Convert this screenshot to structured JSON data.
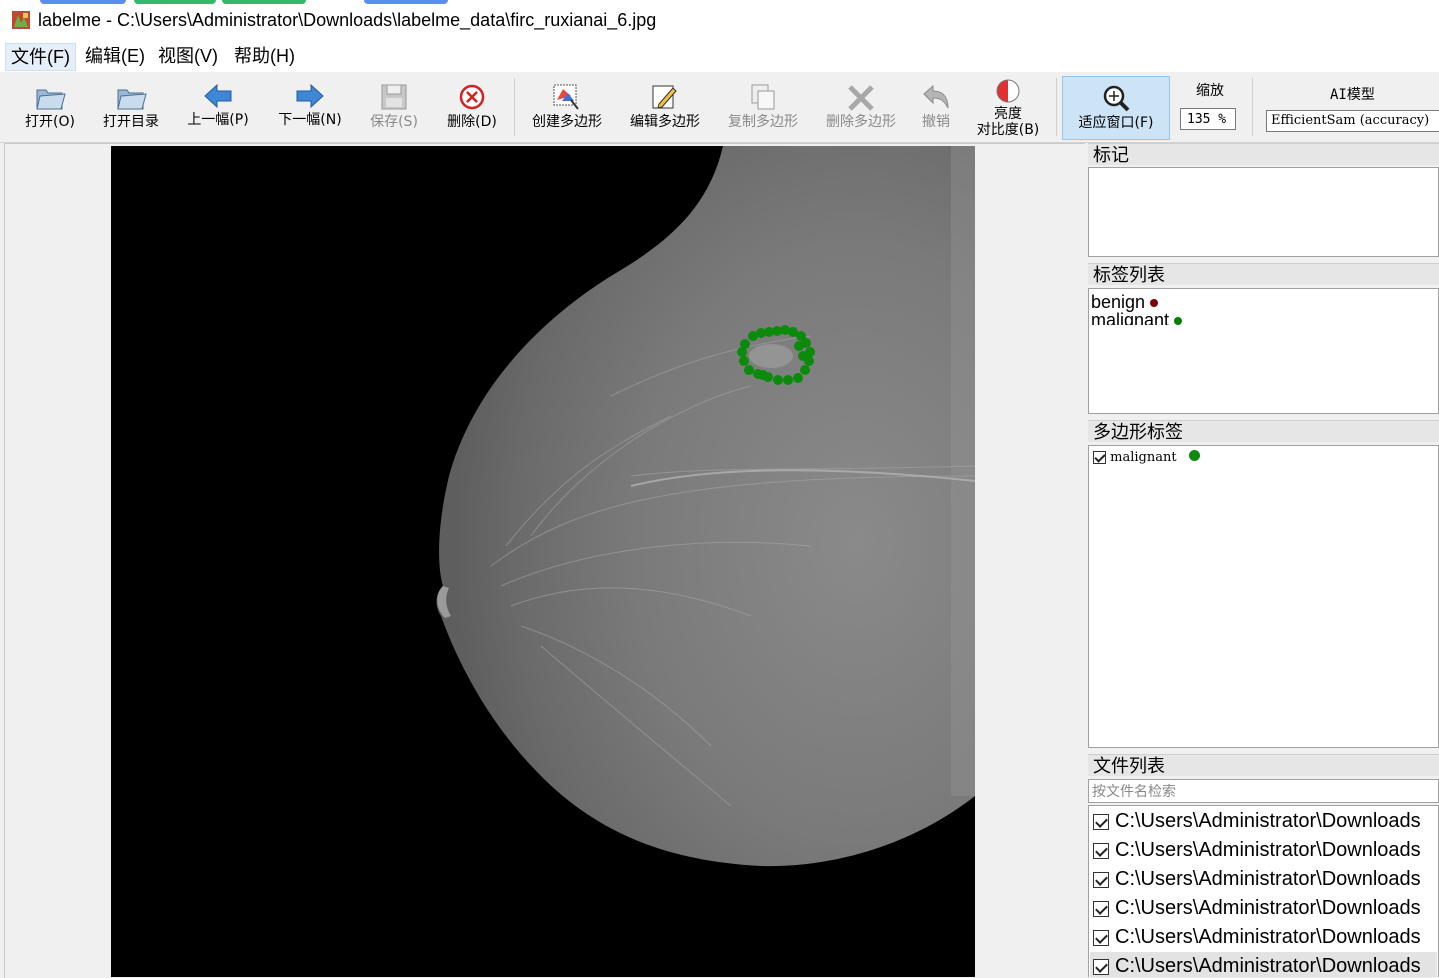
{
  "window": {
    "title": "labelme - C:\\Users\\Administrator\\Downloads\\labelme_data\\firc_ruxianai_6.jpg",
    "app_icon": "labelme-app-icon"
  },
  "menu": {
    "items": [
      {
        "label": "文件(F)"
      },
      {
        "label": "编辑(E)"
      },
      {
        "label": "视图(V)"
      },
      {
        "label": "帮助(H)"
      }
    ]
  },
  "toolbar": {
    "open": "打开(O)",
    "open_dir": "打开目录",
    "prev": "上一幅(P)",
    "next": "下一幅(N)",
    "save": "保存(S)",
    "delete": "删除(D)",
    "create_polygon": "创建多边形",
    "edit_polygon": "编辑多边形",
    "duplicate_polygon": "复制多边形",
    "delete_polygon": "删除多边形",
    "undo": "撤销",
    "brightness_line1": "亮度",
    "brightness_line2": "对比度(B)",
    "fit_window": "适应窗口(F)",
    "zoom_label": "缩放",
    "zoom_value": "135 %",
    "ai_label": "AI模型",
    "ai_model": "EfficientSam (accuracy)"
  },
  "docks": {
    "flags_title": "标记",
    "labels_title": "标签列表",
    "labels": [
      {
        "name": "benign",
        "color": "#7a0000"
      },
      {
        "name": "malignant",
        "color": "#008000"
      }
    ],
    "polygons_title": "多边形标签",
    "polygons": [
      {
        "name": "malignant",
        "color": "#008000",
        "checked": true
      }
    ],
    "files_title": "文件列表",
    "file_search_placeholder": "按文件名检索",
    "files": [
      "C:\\Users\\Administrator\\Downloads",
      "C:\\Users\\Administrator\\Downloads",
      "C:\\Users\\Administrator\\Downloads",
      "C:\\Users\\Administrator\\Downloads",
      "C:\\Users\\Administrator\\Downloads",
      "C:\\Users\\Administrator\\Downloads"
    ]
  },
  "colors": {
    "polygon": "#0b8a0b",
    "fit_window_checked": "#cde4f7"
  }
}
